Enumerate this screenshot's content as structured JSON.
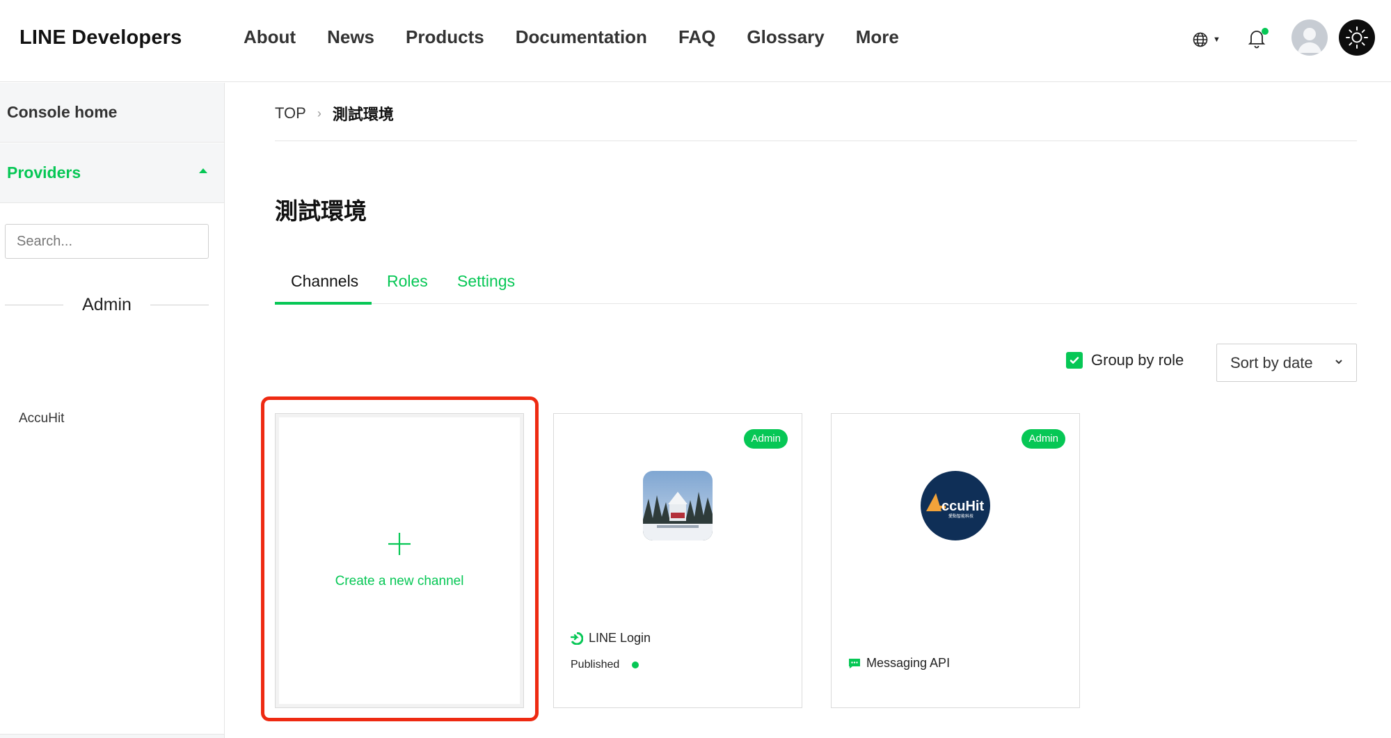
{
  "header": {
    "brand": "LINE Developers",
    "nav": [
      "About",
      "News",
      "Products",
      "Documentation",
      "FAQ",
      "Glossary",
      "More"
    ]
  },
  "sidebar": {
    "console_home": "Console home",
    "providers": "Providers",
    "search_placeholder": "Search...",
    "section_label": "Admin",
    "items": [
      "AccuHit"
    ]
  },
  "breadcrumb": {
    "top": "TOP",
    "current": "測試環境"
  },
  "page": {
    "title": "測試環境"
  },
  "tabs": [
    "Channels",
    "Roles",
    "Settings"
  ],
  "toolbar": {
    "group_by_role": "Group by role",
    "sort": "Sort by date"
  },
  "cards": {
    "create_label": "Create a new channel",
    "login": {
      "badge": "Admin",
      "type": "LINE Login",
      "status": "Published"
    },
    "messaging": {
      "badge": "Admin",
      "type": "Messaging API",
      "logo_text": "ccuHit",
      "logo_sub": "愛點智能科技"
    }
  },
  "colors": {
    "accent": "#06c755",
    "highlight": "#ee2a12"
  }
}
